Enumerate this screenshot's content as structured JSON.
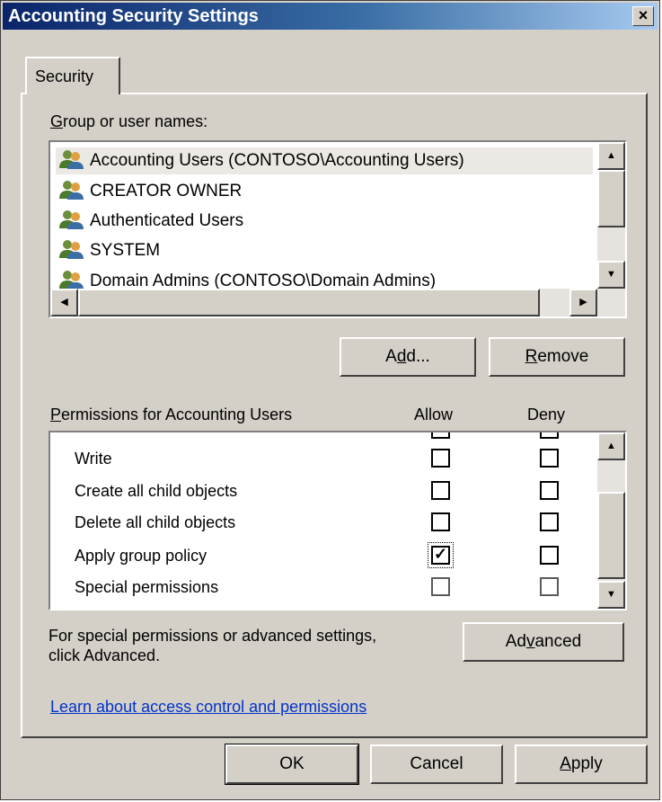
{
  "window": {
    "title": "Accounting Security Settings",
    "close_glyph": "×"
  },
  "tabs": [
    {
      "label": "Security"
    }
  ],
  "group_list": {
    "label_prefix": "",
    "label_accel": "G",
    "label_rest": "roup or user names:",
    "items": [
      {
        "name": "Accounting Users (CONTOSO\\Accounting Users)",
        "icon": "users-group-icon"
      },
      {
        "name": "CREATOR OWNER",
        "icon": "users-group-icon"
      },
      {
        "name": "Authenticated Users",
        "icon": "users-group-icon"
      },
      {
        "name": "SYSTEM",
        "icon": "users-group-icon"
      },
      {
        "name": "Domain Admins (CONTOSO\\Domain Admins)",
        "icon": "users-group-icon"
      }
    ],
    "selected_index": 0
  },
  "buttons": {
    "add_pre": "A",
    "add_accel": "d",
    "add_post": "d...",
    "remove_accel": "R",
    "remove_post": "emove",
    "advanced_pre": "Ad",
    "advanced_accel": "v",
    "advanced_post": "anced",
    "ok": "OK",
    "cancel": "Cancel",
    "apply_accel": "A",
    "apply_post": "pply"
  },
  "permissions": {
    "label_accel": "P",
    "label_rest": "ermissions for Accounting Users",
    "allow_header": "Allow",
    "deny_header": "Deny",
    "rows": [
      {
        "name": "Write",
        "allow": false,
        "deny": false
      },
      {
        "name": "Create all child objects",
        "allow": false,
        "deny": false
      },
      {
        "name": "Delete all child objects",
        "allow": false,
        "deny": false
      },
      {
        "name": "Apply group policy",
        "allow": true,
        "deny": false
      },
      {
        "name": "Special permissions",
        "allow": false,
        "deny": false
      }
    ],
    "check_glyph": "✓"
  },
  "advanced_text_line1": "For special permissions or advanced settings,",
  "advanced_text_line2": "click Advanced.",
  "learn_link": "Learn about access control and permissions",
  "colors": {
    "titlebar_start": "#0a246a",
    "titlebar_end": "#a6caf0",
    "dialog_face": "#d4d0c8",
    "link": "#0033cc"
  }
}
